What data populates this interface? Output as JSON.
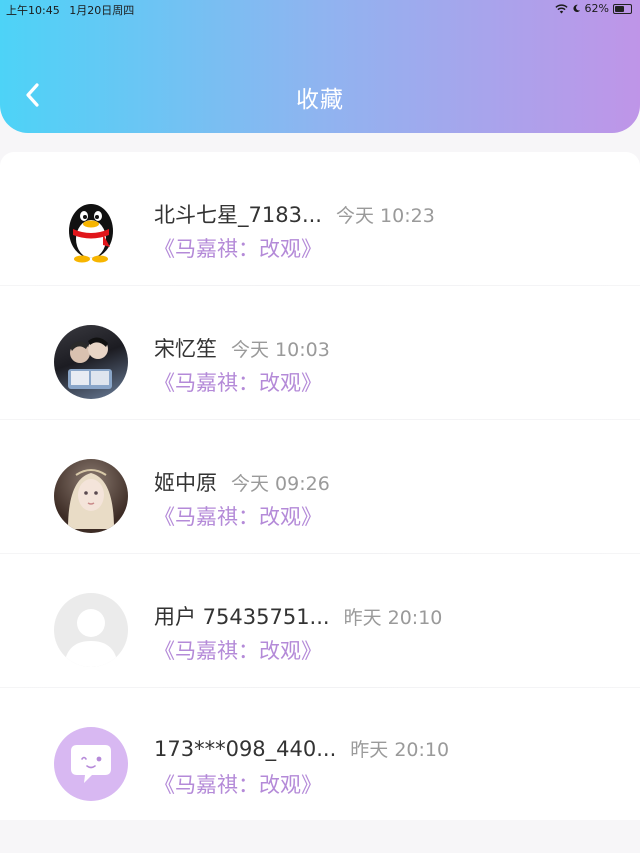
{
  "status_bar": {
    "time": "上午10:45",
    "date": "1月20日周四",
    "battery": "62%",
    "battery_level": 0.62
  },
  "header": {
    "title": "收藏",
    "back_icon": "chevron-left-icon"
  },
  "colors": {
    "gradient_start": "#4dd3f7",
    "gradient_end": "#bf95e8",
    "accent_text": "#b48ad8",
    "time_text": "#9a9a9a"
  },
  "favorites": [
    {
      "name": "北斗七星_7183...",
      "time": "今天 10:23",
      "work": "《马嘉祺：改观》",
      "avatar": "qq-penguin-avatar"
    },
    {
      "name": "宋忆笙",
      "time": "今天 10:03",
      "work": "《马嘉祺：改观》",
      "avatar": "photo-avatar-reading-boys"
    },
    {
      "name": "姬中原",
      "time": "今天 09:26",
      "work": "《马嘉祺：改观》",
      "avatar": "photo-avatar-girl"
    },
    {
      "name": "用户 75435751...",
      "time": "昨天 20:10",
      "work": "《马嘉祺：改观》",
      "avatar": "default-user-avatar"
    },
    {
      "name": "173***098_440...",
      "time": "昨天 20:10",
      "work": "《马嘉祺：改观》",
      "avatar": "chat-bubble-avatar"
    }
  ]
}
